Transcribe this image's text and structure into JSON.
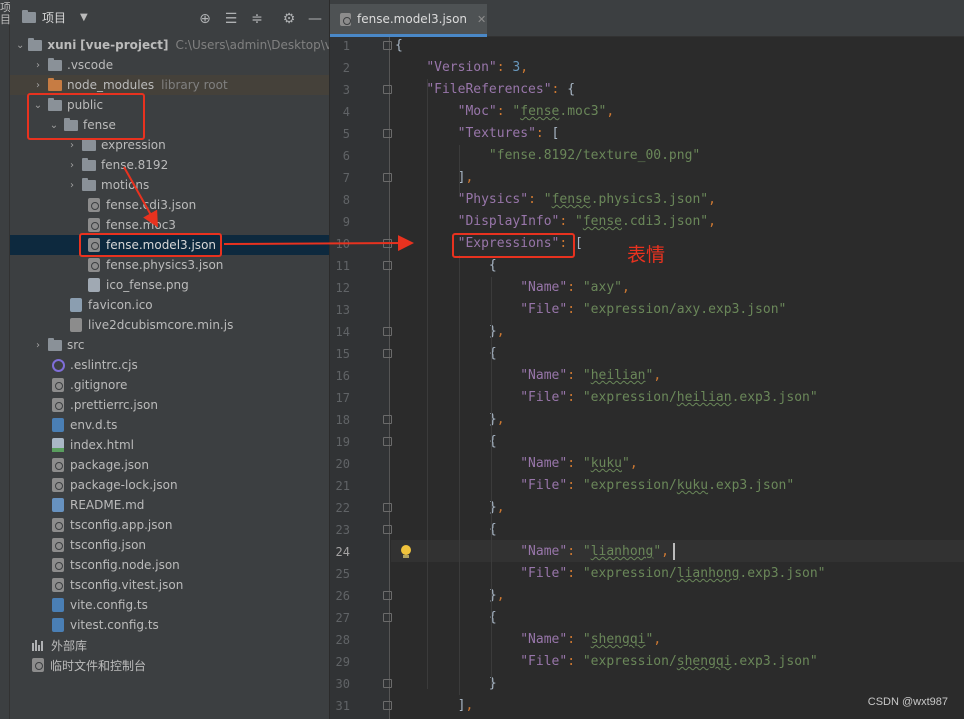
{
  "strip": {
    "label": "项目"
  },
  "project": {
    "title": "项目",
    "dropdown_icon": "caret-down-icon",
    "header_icons": [
      "locate-icon",
      "expand-all-icon",
      "collapse-all-icon",
      "gear-icon",
      "hide-icon"
    ],
    "root": {
      "name": "xuni",
      "tag": "[vue-project]",
      "path": "C:\\Users\\admin\\Desktop\\vue"
    },
    "items": [
      {
        "label": ".vscode"
      },
      {
        "label": "node_modules",
        "note": "library root"
      },
      {
        "label": "public"
      },
      {
        "label": "fense"
      },
      {
        "label": "expression"
      },
      {
        "label": "fense.8192"
      },
      {
        "label": "motions"
      },
      {
        "label": "fense.cdi3.json"
      },
      {
        "label": "fense.moc3"
      },
      {
        "label": "fense.model3.json"
      },
      {
        "label": "fense.physics3.json"
      },
      {
        "label": "ico_fense.png"
      },
      {
        "label": "favicon.ico"
      },
      {
        "label": "live2dcubismcore.min.js"
      },
      {
        "label": "src"
      },
      {
        "label": ".eslintrc.cjs"
      },
      {
        "label": ".gitignore"
      },
      {
        "label": ".prettierrc.json"
      },
      {
        "label": "env.d.ts"
      },
      {
        "label": "index.html"
      },
      {
        "label": "package.json"
      },
      {
        "label": "package-lock.json"
      },
      {
        "label": "README.md"
      },
      {
        "label": "tsconfig.app.json"
      },
      {
        "label": "tsconfig.json"
      },
      {
        "label": "tsconfig.node.json"
      },
      {
        "label": "tsconfig.vitest.json"
      },
      {
        "label": "vite.config.ts"
      },
      {
        "label": "vitest.config.ts"
      }
    ],
    "external_libraries": "外部库",
    "scratches": "临时文件和控制台"
  },
  "editor": {
    "tab_label": "fense.model3.json",
    "current_line": 24,
    "lines": [
      {
        "n": "1",
        "code": "{"
      },
      {
        "n": "2",
        "code": "    \"Version\": 3,"
      },
      {
        "n": "3",
        "code": "    \"FileReferences\": {"
      },
      {
        "n": "4",
        "code": "        \"Moc\": \"fense.moc3\","
      },
      {
        "n": "5",
        "code": "        \"Textures\": ["
      },
      {
        "n": "6",
        "code": "            \"fense.8192/texture_00.png\""
      },
      {
        "n": "7",
        "code": "        ],"
      },
      {
        "n": "8",
        "code": "        \"Physics\": \"fense.physics3.json\","
      },
      {
        "n": "9",
        "code": "        \"DisplayInfo\": \"fense.cdi3.json\","
      },
      {
        "n": "10",
        "code": "        \"Expressions\": ["
      },
      {
        "n": "11",
        "code": "            {"
      },
      {
        "n": "12",
        "code": "                \"Name\": \"axy\","
      },
      {
        "n": "13",
        "code": "                \"File\": \"expression/axy.exp3.json\""
      },
      {
        "n": "14",
        "code": "            },"
      },
      {
        "n": "15",
        "code": "            {"
      },
      {
        "n": "16",
        "code": "                \"Name\": \"heilian\","
      },
      {
        "n": "17",
        "code": "                \"File\": \"expression/heilian.exp3.json\""
      },
      {
        "n": "18",
        "code": "            },"
      },
      {
        "n": "19",
        "code": "            {"
      },
      {
        "n": "20",
        "code": "                \"Name\": \"kuku\","
      },
      {
        "n": "21",
        "code": "                \"File\": \"expression/kuku.exp3.json\""
      },
      {
        "n": "22",
        "code": "            },"
      },
      {
        "n": "23",
        "code": "            {"
      },
      {
        "n": "24",
        "code": "                \"Name\": \"lianhong\","
      },
      {
        "n": "25",
        "code": "                \"File\": \"expression/lianhong.exp3.json\""
      },
      {
        "n": "26",
        "code": "            },"
      },
      {
        "n": "27",
        "code": "            {"
      },
      {
        "n": "28",
        "code": "                \"Name\": \"shengqi\","
      },
      {
        "n": "29",
        "code": "                \"File\": \"expression/shengqi.exp3.json\""
      },
      {
        "n": "30",
        "code": "            }"
      },
      {
        "n": "31",
        "code": "        ],"
      }
    ]
  },
  "annotation": {
    "text": "表情",
    "color": "#e8321f"
  },
  "watermark": "CSDN @wxt987",
  "colors": {
    "key": "#9876aa",
    "string": "#6a8759",
    "number": "#6897bb",
    "punct": "#cc7832",
    "selection": "#0d293e"
  }
}
